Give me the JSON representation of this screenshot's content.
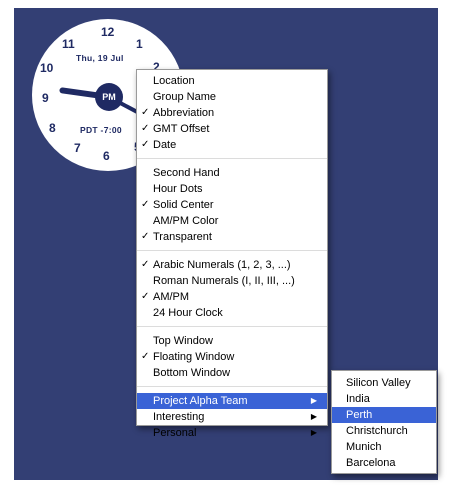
{
  "clock": {
    "numerals": [
      "12",
      "1",
      "2",
      "7",
      "6",
      "5",
      "8",
      "9",
      "10",
      "11"
    ],
    "date_text": "Thu, 19 Jul",
    "gmt_offset_text": "PDT -7:00",
    "center_text": "PM"
  },
  "menu": {
    "group1": [
      {
        "label": "Location",
        "checked": ""
      },
      {
        "label": "Group Name",
        "checked": ""
      },
      {
        "label": "Abbreviation",
        "checked": "✓"
      },
      {
        "label": "GMT Offset",
        "checked": "✓"
      },
      {
        "label": "Date",
        "checked": "✓"
      }
    ],
    "group2": [
      {
        "label": "Second Hand",
        "checked": ""
      },
      {
        "label": "Hour Dots",
        "checked": ""
      },
      {
        "label": "Solid Center",
        "checked": "✓"
      },
      {
        "label": "AM/PM Color",
        "checked": ""
      },
      {
        "label": "Transparent",
        "checked": "✓"
      }
    ],
    "group3": [
      {
        "label": "Arabic Numerals (1, 2, 3, ...)",
        "checked": "✓"
      },
      {
        "label": "Roman Numerals (I, II, III, ...)",
        "checked": ""
      },
      {
        "label": "AM/PM",
        "checked": "✓"
      },
      {
        "label": "24 Hour Clock",
        "checked": ""
      }
    ],
    "group4": [
      {
        "label": "Top Window",
        "checked": ""
      },
      {
        "label": "Floating Window",
        "checked": "✓"
      },
      {
        "label": "Bottom Window",
        "checked": ""
      }
    ],
    "group5": [
      {
        "label": "Project Alpha Team",
        "arrow": "▶"
      },
      {
        "label": "Interesting",
        "arrow": "▶"
      },
      {
        "label": "Personal",
        "arrow": "▶"
      }
    ]
  },
  "submenu": {
    "items": [
      "Silicon Valley",
      "India",
      "Perth",
      "Christchurch",
      "Munich",
      "Barcelona"
    ]
  },
  "colors": {
    "desktop": "#333f74",
    "clock_ink": "#1f2a63",
    "highlight": "#3a63d6"
  }
}
